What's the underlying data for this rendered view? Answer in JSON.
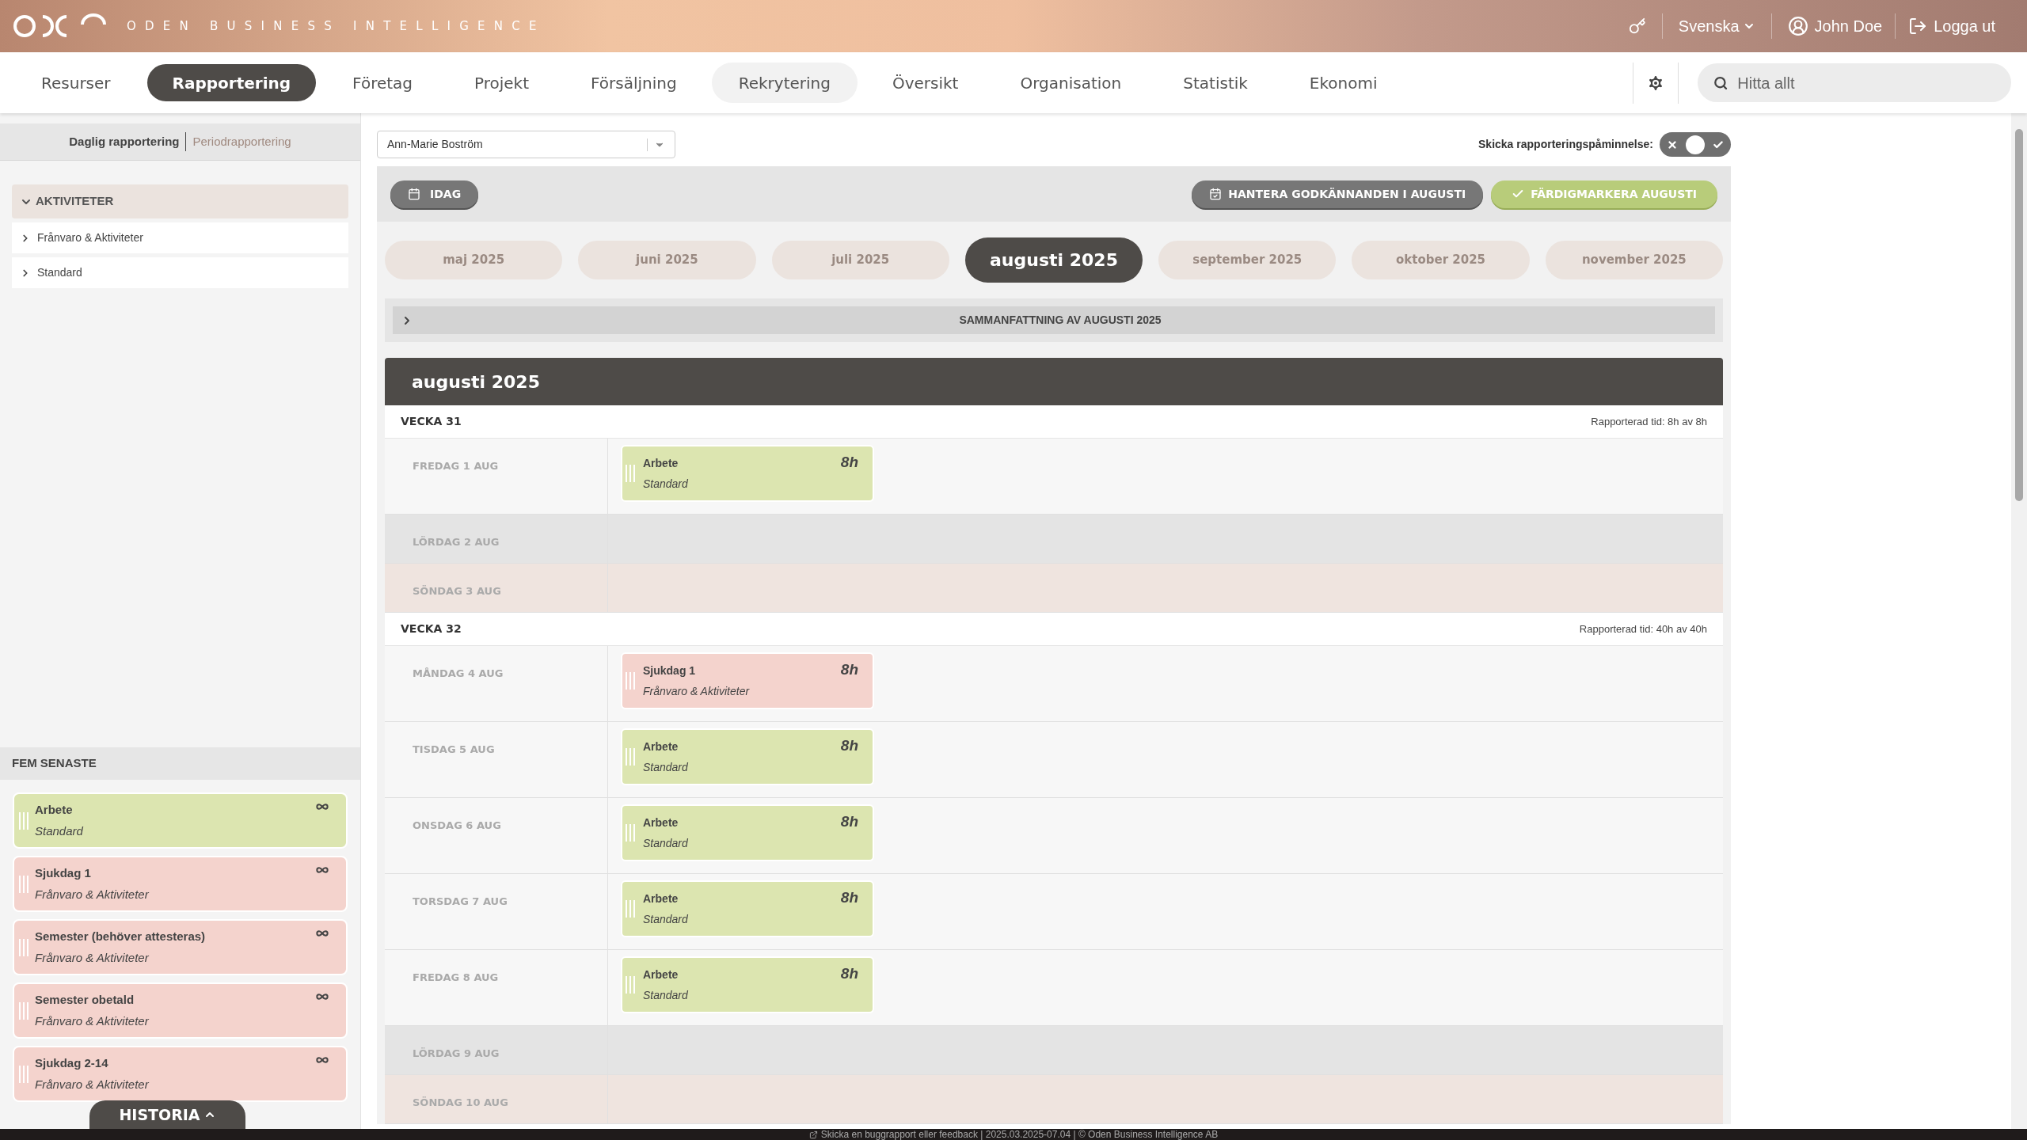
{
  "header": {
    "brand": "ODEN BUSINESS INTELLIGENCE",
    "language": "Svenska",
    "user": "John Doe",
    "logout": "Logga ut"
  },
  "nav": {
    "items": [
      {
        "label": "Resurser",
        "selected": false,
        "hovered": false
      },
      {
        "label": "Rapportering",
        "selected": true,
        "hovered": false
      },
      {
        "label": "Företag",
        "selected": false,
        "hovered": false
      },
      {
        "label": "Projekt",
        "selected": false,
        "hovered": false
      },
      {
        "label": "Försäljning",
        "selected": false,
        "hovered": false
      },
      {
        "label": "Rekrytering",
        "selected": false,
        "hovered": true
      },
      {
        "label": "Översikt",
        "selected": false,
        "hovered": false
      },
      {
        "label": "Organisation",
        "selected": false,
        "hovered": false
      },
      {
        "label": "Statistik",
        "selected": false,
        "hovered": false
      },
      {
        "label": "Ekonomi",
        "selected": false,
        "hovered": false
      }
    ],
    "search": {
      "placeholder": "Hitta allt"
    }
  },
  "sidebar": {
    "tabs": [
      {
        "label": "Daglig rapportering",
        "selected": true
      },
      {
        "label": "Periodrapportering",
        "selected": false
      }
    ],
    "activities": {
      "title": "AKTIVITETER",
      "expanded": true,
      "children": [
        {
          "label": "Frånvaro & Aktiviteter",
          "expanded": false
        },
        {
          "label": "Standard",
          "expanded": false
        }
      ]
    },
    "recent": {
      "title": "FEM SENASTE",
      "items": [
        {
          "name": "Arbete",
          "category": "Standard",
          "color": "#dce5b0"
        },
        {
          "name": "Sjukdag 1",
          "category": "Frånvaro & Aktiviteter",
          "color": "#f4d3cd"
        },
        {
          "name": "Semester (behöver attesteras)",
          "category": "Frånvaro & Aktiviteter",
          "color": "#f4d3cd"
        },
        {
          "name": "Semester obetald",
          "category": "Frånvaro & Aktiviteter",
          "color": "#f4d3cd"
        },
        {
          "name": "Sjukdag 2-14",
          "category": "Frånvaro & Aktiviteter",
          "color": "#f4d3cd"
        }
      ]
    },
    "history": "HISTORIA"
  },
  "main": {
    "employee": "Ann-Marie Boström",
    "reminder_label": "Skicka rapporteringspåminnelse:",
    "buttons": {
      "today": "IDAG",
      "manage": "HANTERA GODKÄNNANDEN I AUGUSTI",
      "complete": "FÄRDIGMARKERA AUGUSTI"
    },
    "months": [
      {
        "label": "maj 2025",
        "selected": false
      },
      {
        "label": "juni 2025",
        "selected": false
      },
      {
        "label": "juli 2025",
        "selected": false
      },
      {
        "label": "augusti 2025",
        "selected": true
      },
      {
        "label": "september 2025",
        "selected": false
      },
      {
        "label": "oktober 2025",
        "selected": false
      },
      {
        "label": "november 2025",
        "selected": false
      }
    ],
    "summary": {
      "label": "SAMMANFATTNING AV AUGUSTI 2025",
      "expanded": false
    },
    "calendar": {
      "title": "augusti 2025",
      "weeks": [
        {
          "label": "VECKA 31",
          "reported": "Rapporterad tid: 8h av 8h",
          "days": [
            {
              "label": "FREDAG 1 AUG",
              "kind": "weekday",
              "entries": [
                {
                  "name": "Arbete",
                  "category": "Standard",
                  "hours": "8h",
                  "color": "#dce5b0"
                }
              ]
            },
            {
              "label": "LÖRDAG 2 AUG",
              "kind": "saturday"
            },
            {
              "label": "SÖNDAG 3 AUG",
              "kind": "sunday"
            }
          ]
        },
        {
          "label": "VECKA 32",
          "reported": "Rapporterad tid: 40h av 40h",
          "days": [
            {
              "label": "MÅNDAG 4 AUG",
              "kind": "weekday",
              "entries": [
                {
                  "name": "Sjukdag 1",
                  "category": "Frånvaro & Aktiviteter",
                  "hours": "8h",
                  "color": "#f4d3cd"
                }
              ]
            },
            {
              "label": "TISDAG 5 AUG",
              "kind": "weekday",
              "entries": [
                {
                  "name": "Arbete",
                  "category": "Standard",
                  "hours": "8h",
                  "color": "#dce5b0"
                }
              ]
            },
            {
              "label": "ONSDAG 6 AUG",
              "kind": "weekday",
              "entries": [
                {
                  "name": "Arbete",
                  "category": "Standard",
                  "hours": "8h",
                  "color": "#dce5b0"
                }
              ]
            },
            {
              "label": "TORSDAG 7 AUG",
              "kind": "weekday",
              "entries": [
                {
                  "name": "Arbete",
                  "category": "Standard",
                  "hours": "8h",
                  "color": "#dce5b0"
                }
              ]
            },
            {
              "label": "FREDAG 8 AUG",
              "kind": "weekday",
              "entries": [
                {
                  "name": "Arbete",
                  "category": "Standard",
                  "hours": "8h",
                  "color": "#dce5b0"
                }
              ]
            },
            {
              "label": "LÖRDAG 9 AUG",
              "kind": "saturday"
            },
            {
              "label": "SÖNDAG 10 AUG",
              "kind": "sunday"
            }
          ]
        }
      ]
    }
  },
  "footer": "Skicka en buggrapport eller feedback | 2025.03.2025-07.04 | © Oden Business Intelligence AB"
}
